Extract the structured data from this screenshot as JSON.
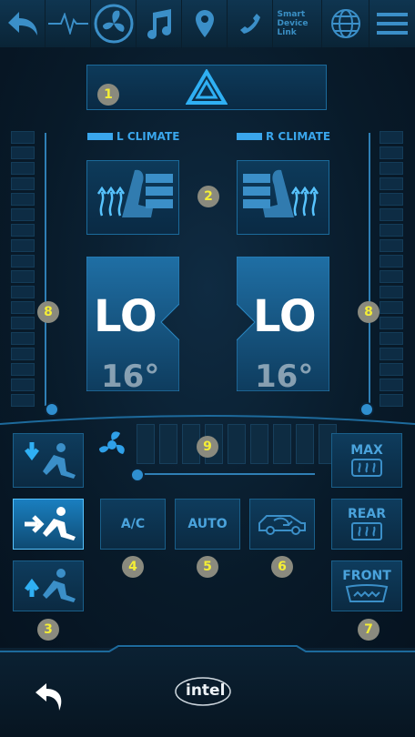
{
  "top_nav": {
    "items": [
      {
        "icon": "back-arrow-icon"
      },
      {
        "icon": "pulse-icon"
      },
      {
        "icon": "fan-icon"
      },
      {
        "icon": "music-note-icon"
      },
      {
        "icon": "map-pin-icon"
      },
      {
        "icon": "phone-icon"
      },
      {
        "icon": "smart-device-link-icon",
        "label": "Smart Device Link"
      },
      {
        "icon": "globe-icon"
      },
      {
        "icon": "hamburger-menu-icon"
      }
    ]
  },
  "hazard": {
    "icon": "hazard-triangle-icon",
    "badge": "1"
  },
  "climate": {
    "left_label": "L CLIMATE",
    "right_label": "R CLIMATE",
    "seat_badge": "2",
    "left_temp": "LO",
    "left_temp_deg": "16°",
    "right_temp": "LO",
    "right_temp_deg": "16°",
    "temp_badge_left": "8",
    "temp_badge_right": "8"
  },
  "fan": {
    "badge": "9",
    "level_segments": 9
  },
  "buttons": {
    "ac": "A/C",
    "auto": "AUTO",
    "max": "MAX",
    "rear": "REAR",
    "front": "FRONT",
    "badge_airflow": "3",
    "badge_ac": "4",
    "badge_auto": "5",
    "badge_recirc": "6",
    "badge_defrost": "7"
  },
  "colors": {
    "accent": "#3aa6ec",
    "badge_text": "#f4ee36",
    "badge_bg": "#8a8a7e"
  },
  "bottom": {
    "brand": "intel"
  }
}
